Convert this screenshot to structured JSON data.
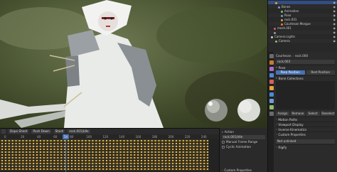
{
  "outliner": {
    "rows": [
      {
        "label": "",
        "color": "#e9a23b",
        "sel": true,
        "indent": 10
      },
      {
        "label": "Bones",
        "color": "#6aa0d8",
        "sel": false,
        "indent": 14
      },
      {
        "label": "Animation",
        "color": "#8fbf6a",
        "sel": false,
        "indent": 18
      },
      {
        "label": "Pose",
        "color": "#6aa0d8",
        "sel": false,
        "indent": 18
      },
      {
        "label": "rock.001",
        "color": "#d9a24a",
        "sel": false,
        "indent": 18
      },
      {
        "label": "Courtesan Morgue",
        "color": "#e8823b",
        "sel": false,
        "indent": 18
      },
      {
        "label": "mesh.001",
        "color": "#d06060",
        "sel": false,
        "indent": 8
      },
      {
        "label": "",
        "color": "#999999",
        "sel": false,
        "indent": 8
      },
      {
        "label": "Camera Lights",
        "color": "#cccccc",
        "sel": false,
        "indent": 4
      },
      {
        "label": "Camera",
        "color": "#8fbf6a",
        "sel": false,
        "indent": 10
      }
    ]
  },
  "properties": {
    "object_name": "Courtesan",
    "armature_name": "rock.000",
    "data_name": "rock.003",
    "pose_label": "Pose",
    "pose_position": "Pose Position",
    "rest_position": "Rest Position",
    "bone_collections": "Bone Collections",
    "tabs": [
      "Assign",
      "Remove",
      "Select",
      "Deselect"
    ],
    "sections": [
      "Motion Paths",
      "Viewport Display",
      "Inverse Kinematics",
      "Custom Properties"
    ],
    "not_unlinked": "Not unlinked",
    "rigify": "Rigify"
  },
  "timeline": {
    "mode": "Dope Sheet",
    "header_items": [
      "Push Down",
      "Stash",
      "rock.001|Idle"
    ],
    "current_frame": "54",
    "ticks": [
      "0",
      "20",
      "40",
      "60",
      "80",
      "100",
      "120",
      "140",
      "160",
      "180",
      "200",
      "220",
      "240"
    ]
  },
  "action_panel": {
    "title": "Action",
    "action_name": "rock.001|Idle",
    "manual_frame_range": "Manual Frame Range",
    "cyclic": "Cyclic Animation",
    "custom_properties": "Custom Properties"
  },
  "colors": {
    "accent": "#4772b3",
    "keyframe": "#e8b84a"
  }
}
